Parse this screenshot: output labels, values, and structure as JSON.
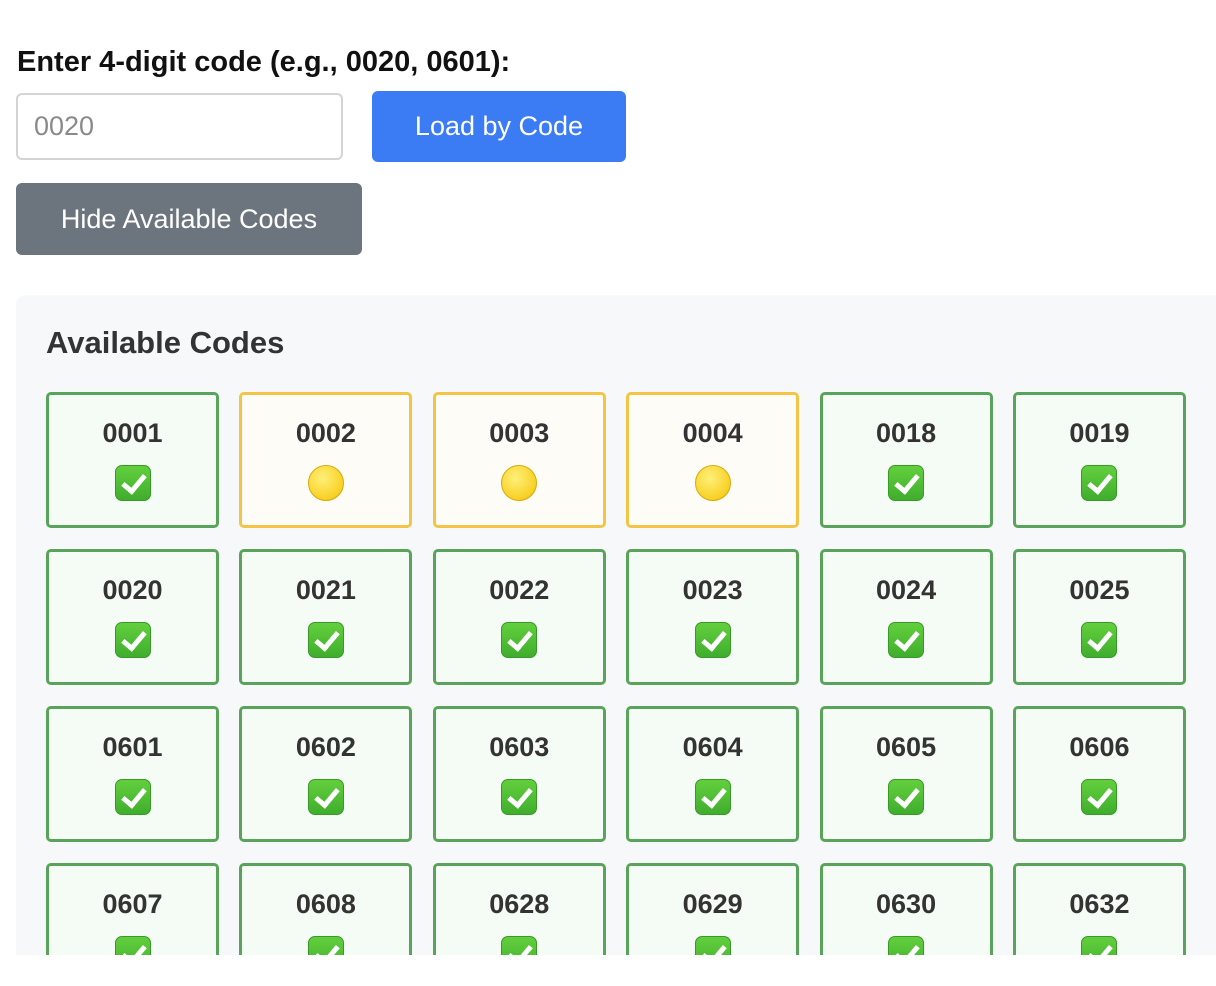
{
  "header": {
    "code_label": "Enter 4-digit code (e.g., 0020, 0601):"
  },
  "code_input": {
    "value": "",
    "placeholder": "0020"
  },
  "buttons": {
    "load_label": "Load by Code",
    "hide_label": "Hide Available Codes"
  },
  "available_codes": {
    "title": "Available Codes",
    "items": [
      {
        "code": "0001",
        "status": "complete",
        "icon": "check-mark-icon"
      },
      {
        "code": "0002",
        "status": "pending",
        "icon": "yellow-circle-icon"
      },
      {
        "code": "0003",
        "status": "pending",
        "icon": "yellow-circle-icon"
      },
      {
        "code": "0004",
        "status": "pending",
        "icon": "yellow-circle-icon"
      },
      {
        "code": "0018",
        "status": "complete",
        "icon": "check-mark-icon"
      },
      {
        "code": "0019",
        "status": "complete",
        "icon": "check-mark-icon"
      },
      {
        "code": "0020",
        "status": "complete",
        "icon": "check-mark-icon"
      },
      {
        "code": "0021",
        "status": "complete",
        "icon": "check-mark-icon"
      },
      {
        "code": "0022",
        "status": "complete",
        "icon": "check-mark-icon"
      },
      {
        "code": "0023",
        "status": "complete",
        "icon": "check-mark-icon"
      },
      {
        "code": "0024",
        "status": "complete",
        "icon": "check-mark-icon"
      },
      {
        "code": "0025",
        "status": "complete",
        "icon": "check-mark-icon"
      },
      {
        "code": "0601",
        "status": "complete",
        "icon": "check-mark-icon"
      },
      {
        "code": "0602",
        "status": "complete",
        "icon": "check-mark-icon"
      },
      {
        "code": "0603",
        "status": "complete",
        "icon": "check-mark-icon"
      },
      {
        "code": "0604",
        "status": "complete",
        "icon": "check-mark-icon"
      },
      {
        "code": "0605",
        "status": "complete",
        "icon": "check-mark-icon"
      },
      {
        "code": "0606",
        "status": "complete",
        "icon": "check-mark-icon"
      },
      {
        "code": "0607",
        "status": "complete",
        "icon": "check-mark-icon"
      },
      {
        "code": "0608",
        "status": "complete",
        "icon": "check-mark-icon"
      },
      {
        "code": "0628",
        "status": "complete",
        "icon": "check-mark-icon"
      },
      {
        "code": "0629",
        "status": "complete",
        "icon": "check-mark-icon"
      },
      {
        "code": "0630",
        "status": "complete",
        "icon": "check-mark-icon"
      },
      {
        "code": "0632",
        "status": "complete",
        "icon": "check-mark-icon"
      }
    ]
  },
  "colors": {
    "primary_button": "#3b7cf5",
    "secondary_button": "#6c757d",
    "complete_border": "#5aa35a",
    "pending_border": "#f3c446",
    "panel_background": "#f7f8fa"
  }
}
